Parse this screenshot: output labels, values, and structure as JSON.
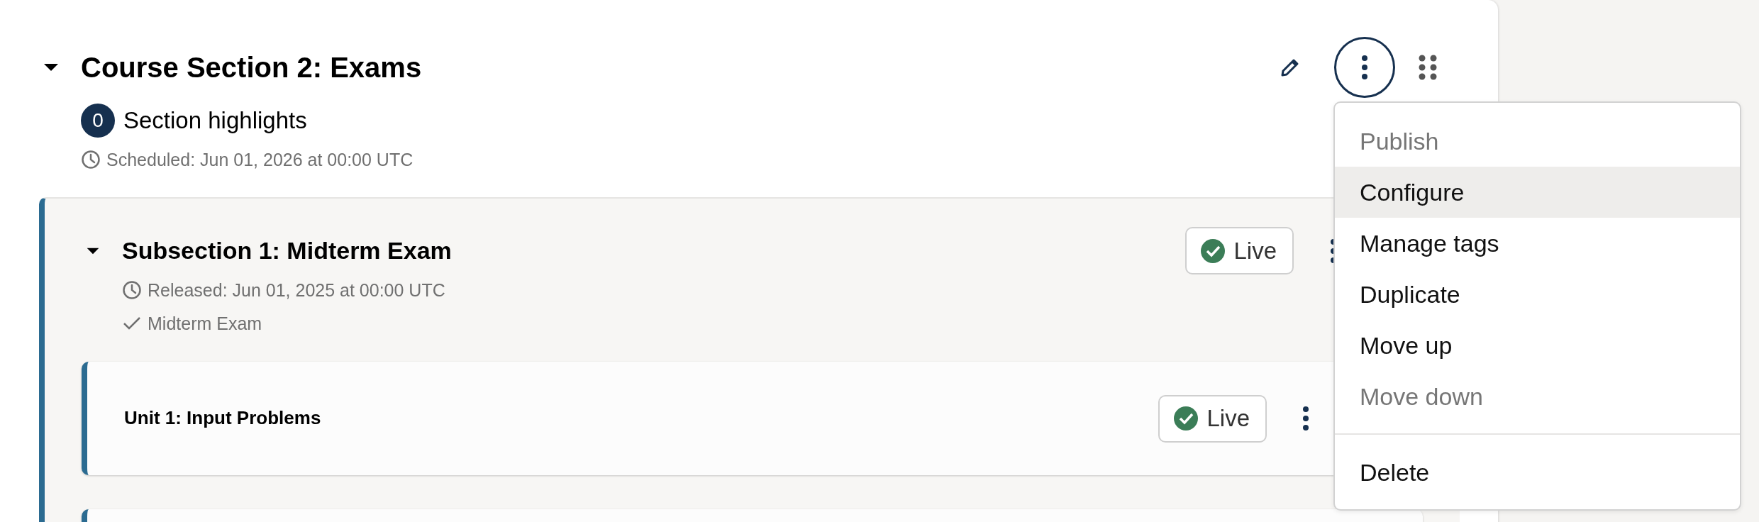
{
  "section": {
    "title": "Course Section 2: Exams",
    "expanded": true,
    "highlights": {
      "count": "0",
      "label": "Section highlights"
    },
    "schedule": "Scheduled: Jun 01, 2026 at 00:00 UTC",
    "subsections": [
      {
        "title": "Subsection 1: Midterm Exam",
        "expanded": true,
        "status": "Live",
        "released": "Released: Jun 01, 2025 at 00:00 UTC",
        "prerequisite": "Midterm Exam",
        "units": [
          {
            "kind": "full",
            "title": "Unit 1: Input Problems",
            "status": "Live"
          },
          {
            "kind": "edge"
          }
        ]
      }
    ]
  },
  "menu": {
    "items": [
      {
        "kind": "item",
        "label": "Publish",
        "disabled": true,
        "selected": false
      },
      {
        "kind": "item",
        "label": "Configure",
        "disabled": false,
        "selected": true
      },
      {
        "kind": "item",
        "label": "Manage tags",
        "disabled": false,
        "selected": false
      },
      {
        "kind": "item",
        "label": "Duplicate",
        "disabled": false,
        "selected": false
      },
      {
        "kind": "item",
        "label": "Move up",
        "disabled": false,
        "selected": false
      },
      {
        "kind": "item",
        "label": "Move down",
        "disabled": true,
        "selected": false
      },
      {
        "kind": "divider"
      },
      {
        "kind": "item",
        "label": "Delete",
        "disabled": false,
        "selected": false
      }
    ]
  }
}
